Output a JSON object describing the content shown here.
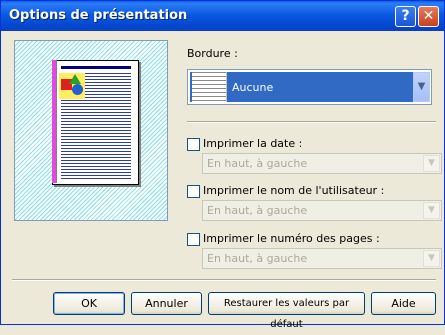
{
  "window": {
    "title": "Options de présentation"
  },
  "titlebar": {
    "help_label": "?",
    "close_label": "✕"
  },
  "border": {
    "label": "Bordure :",
    "selected": "Aucune"
  },
  "options": [
    {
      "label": "Imprimer la date :",
      "checked": false,
      "value": "En haut, à gauche"
    },
    {
      "label": "Imprimer le nom de l'utilisateur :",
      "checked": false,
      "value": "En haut, à gauche"
    },
    {
      "label": "Imprimer le numéro des pages :",
      "checked": false,
      "value": "En haut, à gauche"
    }
  ],
  "buttons": {
    "ok": "OK",
    "cancel": "Annuler",
    "restore": "Restaurer les valeurs par défaut",
    "help": "Aide"
  },
  "icons": {
    "help": "help-icon",
    "close": "close-icon",
    "dropdown": "chevron-down-icon"
  }
}
